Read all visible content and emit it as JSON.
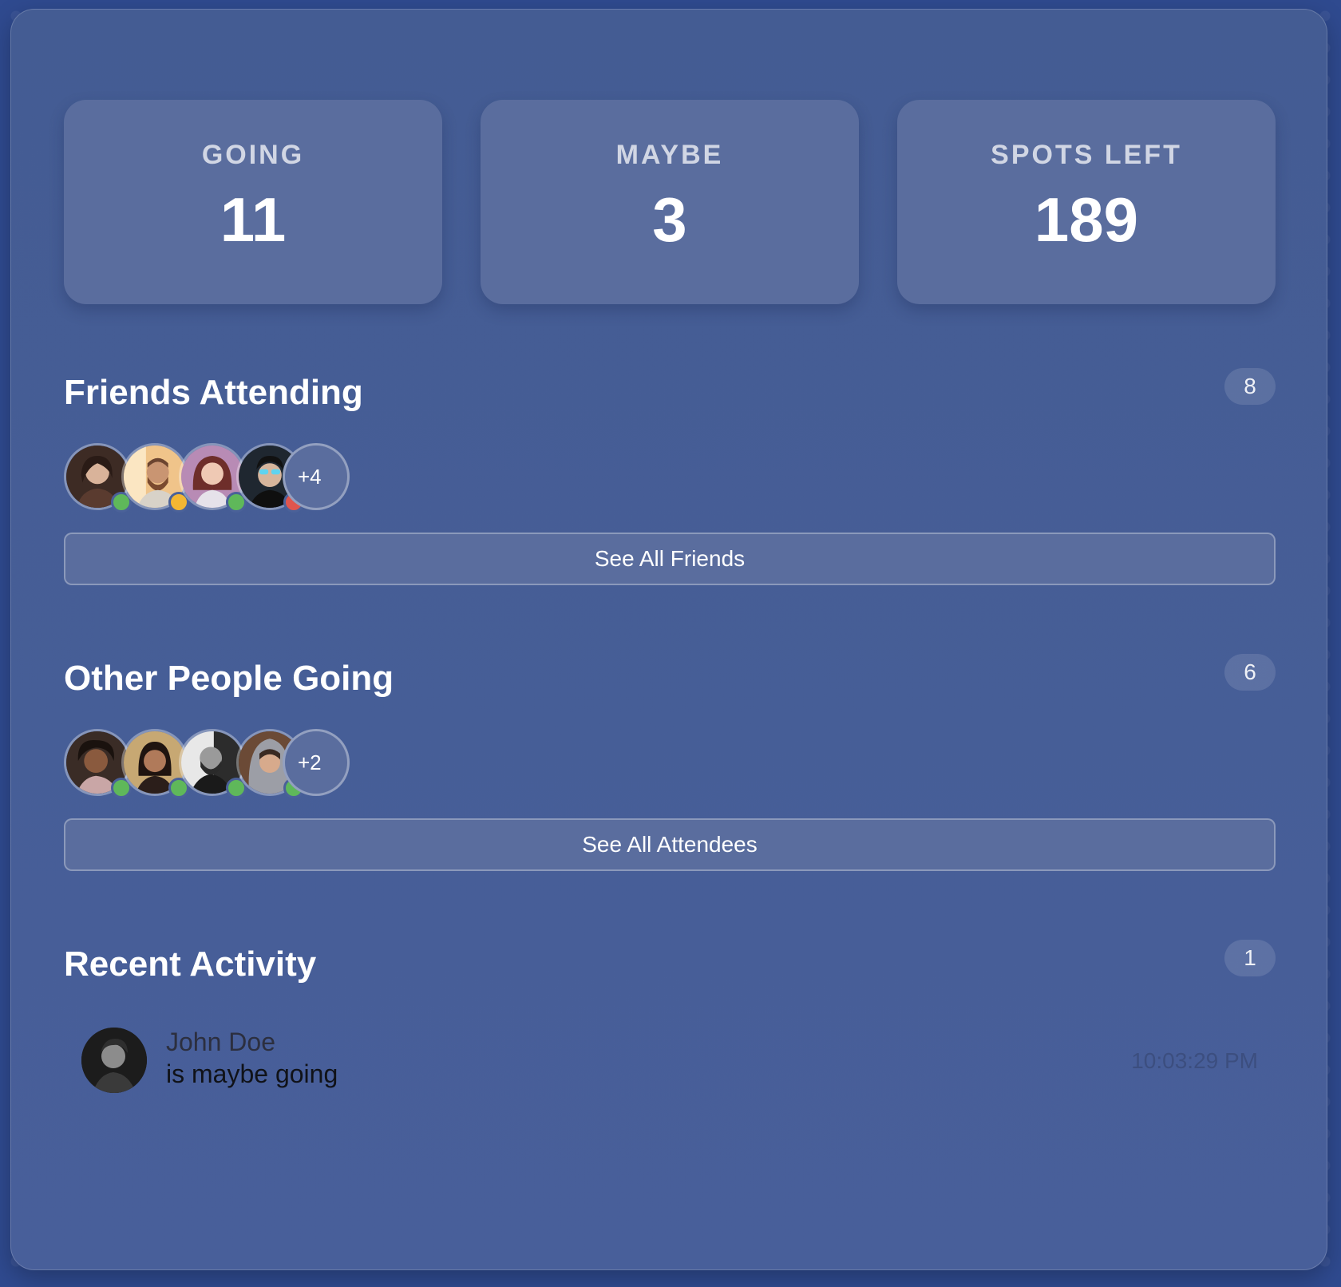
{
  "stats": [
    {
      "label": "GOING",
      "value": "11"
    },
    {
      "label": "MAYBE",
      "value": "3"
    },
    {
      "label": "SPOTS LEFT",
      "value": "189"
    }
  ],
  "friends": {
    "title": "Friends Attending",
    "count": "8",
    "more_label": "+4",
    "avatars": [
      {
        "name": "friend-avatar-1",
        "status": "going",
        "status_color": "#5fb85a"
      },
      {
        "name": "friend-avatar-2",
        "status": "maybe",
        "status_color": "#f3b633"
      },
      {
        "name": "friend-avatar-3",
        "status": "going",
        "status_color": "#5fb85a"
      },
      {
        "name": "friend-avatar-4",
        "status": "not-going",
        "status_color": "#e0554e"
      }
    ],
    "button_label": "See All Friends"
  },
  "others": {
    "title": "Other People Going",
    "count": "6",
    "more_label": "+2",
    "avatars": [
      {
        "name": "attendee-avatar-1",
        "status": "going",
        "status_color": "#5fb85a"
      },
      {
        "name": "attendee-avatar-2",
        "status": "going",
        "status_color": "#5fb85a"
      },
      {
        "name": "attendee-avatar-3",
        "status": "going",
        "status_color": "#5fb85a"
      },
      {
        "name": "attendee-avatar-4",
        "status": "going",
        "status_color": "#5fb85a"
      }
    ],
    "button_label": "See All Attendees"
  },
  "activity": {
    "title": "Recent Activity",
    "count": "1",
    "items": [
      {
        "name": "John Doe",
        "text": "is maybe going",
        "time": "10:03:29 PM"
      }
    ]
  }
}
